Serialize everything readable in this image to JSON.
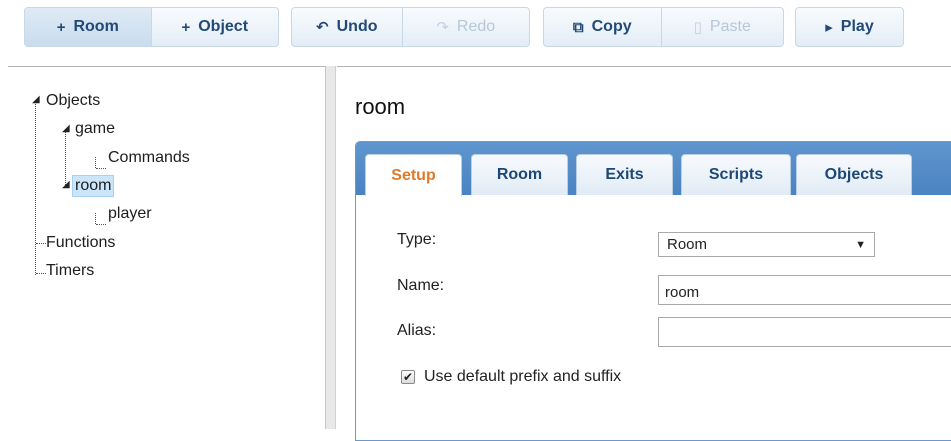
{
  "toolbar": {
    "add_room": {
      "icon": "plus-icon",
      "glyph": "+",
      "label": "Room"
    },
    "add_object": {
      "icon": "plus-icon",
      "glyph": "+",
      "label": "Object"
    },
    "undo": {
      "icon": "undo-icon",
      "glyph": "↶",
      "label": "Undo"
    },
    "redo": {
      "icon": "redo-icon",
      "glyph": "↷",
      "label": "Redo"
    },
    "copy": {
      "icon": "copy-icon",
      "glyph": "⧉",
      "label": "Copy"
    },
    "paste": {
      "icon": "paste-icon",
      "glyph": "▯",
      "label": "Paste"
    },
    "play": {
      "icon": "play-icon",
      "glyph": "▸",
      "label": "Play"
    }
  },
  "tree": {
    "objects": "Objects",
    "game": "game",
    "commands": "Commands",
    "room": "room",
    "player": "player",
    "functions": "Functions",
    "timers": "Timers",
    "selected": "room"
  },
  "editor": {
    "title": "room",
    "tabs": [
      "Setup",
      "Room",
      "Exits",
      "Scripts",
      "Objects"
    ],
    "active_tab": "Setup",
    "type_label": "Type:",
    "type_value": "Room",
    "name_label": "Name:",
    "name_value": "room",
    "alias_label": "Alias:",
    "alias_value": "",
    "prefix_checkbox_label": "Use default prefix and suffix",
    "prefix_checked": true
  },
  "colors": {
    "accent": "#4a83c1",
    "active_tab_text": "#e07a2a",
    "toolbar_text": "#234a77",
    "selection": "#cbe6fb"
  }
}
